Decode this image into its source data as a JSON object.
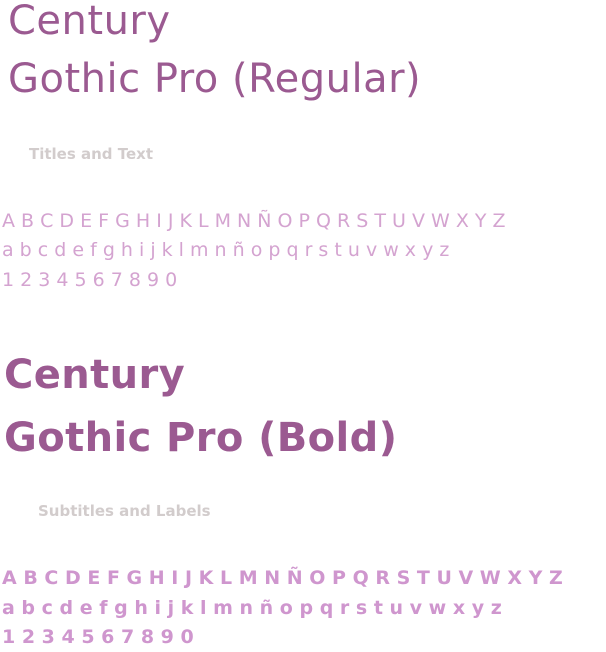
{
  "regular": {
    "title_line1": "Century",
    "title_line2": "Gothic Pro (Regular)",
    "caption": "Titles and Text",
    "uppercase": "A B C D E F G H I J K L M N Ñ O P Q R S T U V W X Y Z",
    "lowercase": "a b c d e f g h i j k l m n ñ o p q r s t u v w x y z",
    "digits": "1 2 3 4 5 6 7 8 9 0"
  },
  "bold": {
    "title_line1": "Century",
    "title_line2": "Gothic Pro (Bold)",
    "caption": "Subtitles and Labels",
    "uppercase": "A B C D E F G H I J K L M N Ñ O P Q R S T U V W X Y Z",
    "lowercase": "a b c d e f g h i j k l m n ñ o p q r s t u v w x y z",
    "digits": "1 2 3 4 5 6 7 8 9 0"
  },
  "colors": {
    "title": "#9b5a91",
    "caption": "#d2cccc",
    "alphabet_regular": "#d4a3d0",
    "alphabet_bold": "#cf96ce",
    "background": "#ffffff"
  }
}
